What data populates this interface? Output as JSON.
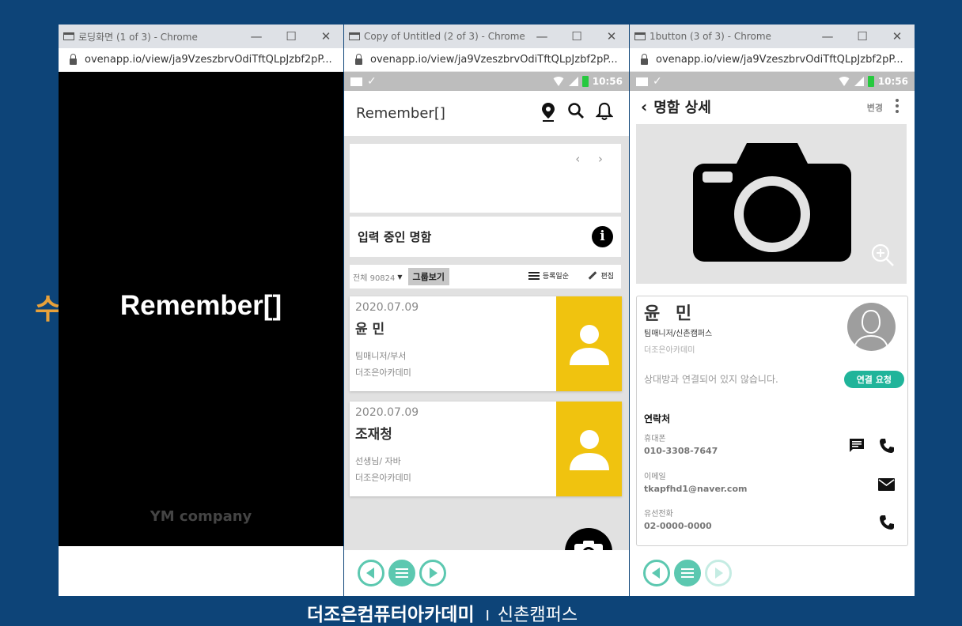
{
  "background": {
    "char": "수",
    "footer_brand": "더조은컴퓨터아카데미",
    "footer_separator": "I",
    "footer_campus": "신촌캠퍼스"
  },
  "windows": [
    {
      "title": "로딩화면 (1 of 3) - Chrome",
      "url": "ovenapp.io/view/ja9VzeszbrvOdiTftQLpJzbf2pP...",
      "controls": {
        "minimize": "—",
        "maximize": "☐",
        "close": "✕"
      },
      "content": {
        "logo": "Remember[]",
        "company": "YM company"
      }
    },
    {
      "title": "Copy of Untitled (2 of 3) - Chrome",
      "url": "ovenapp.io/view/ja9VzeszbrvOdiTftQLpJzbf2pP...",
      "controls": {
        "minimize": "—",
        "maximize": "☐",
        "close": "✕"
      },
      "status": {
        "check": "✓",
        "time": "10:56"
      },
      "content": {
        "brand": "Remember[]",
        "banner_arrows": "‹ ›",
        "pending_title": "입력 중인 명함",
        "info_glyph": "i",
        "filter": {
          "count": "전체 90824",
          "caret": "▼",
          "group_view": "그룹보기",
          "sort": "등록일순",
          "edit": "편집"
        },
        "cards": [
          {
            "date": "2020.07.09",
            "name": "윤  민",
            "role": "팀매니저/부서",
            "org": "더조은아카데미"
          },
          {
            "date": "2020.07.09",
            "name": "조재청",
            "role": "선생님/ 자바",
            "org": "더조은아카데미"
          }
        ]
      }
    },
    {
      "title": "1button (3 of 3) - Chrome",
      "url": "ovenapp.io/view/ja9VzeszbrvOdiTftQLpJzbf2pP...",
      "controls": {
        "minimize": "—",
        "maximize": "☐",
        "close": "✕"
      },
      "status": {
        "check": "✓",
        "time": "10:56"
      },
      "content": {
        "back_glyph": "‹",
        "title": "명함 상세",
        "change": "변경",
        "name": "윤 민",
        "role": "팀매니저/신촌캠퍼스",
        "org": "더조은아카데미",
        "not_connected": "상대방과 연결되어 있지 않습니다.",
        "connect_button": "연결 요청",
        "contact_section": "연락처",
        "fields": [
          {
            "label": "휴대폰",
            "value": "010-3308-7647"
          },
          {
            "label": "이메일",
            "value": "tkapfhd1@naver.com"
          },
          {
            "label": "유선전화",
            "value": "02-0000-0000"
          }
        ]
      }
    }
  ],
  "colors": {
    "background": "#0d4478",
    "accent_teal": "#5cc8b0",
    "connect_button": "#20b49a",
    "card_photo": "#f0c30f"
  }
}
